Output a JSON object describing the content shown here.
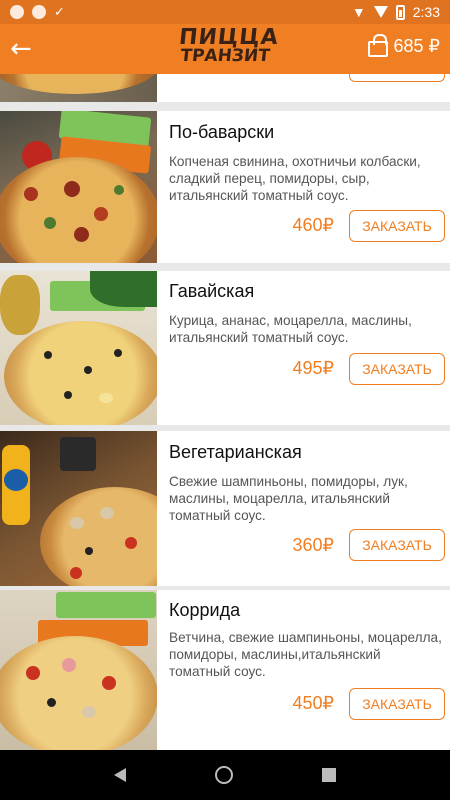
{
  "status_bar": {
    "time": "2:33"
  },
  "app_bar": {
    "logo_line1": "ПИЦЦА",
    "logo_line2": "ТРАНЗИТ",
    "cart_total": "685 ₽"
  },
  "items": [
    {
      "name": "",
      "description": "",
      "price": "",
      "order_label": "",
      "colors": {
        "bg": "#7a7160",
        "crust": "#c58a3c"
      }
    },
    {
      "name": "По-баварски",
      "description": "Копченая свинина, охотничьи колбаски, сладкий перец, помидоры, сыр, итальянский томатный соус.",
      "price": "460₽",
      "order_label": "ЗАКАЗАТЬ",
      "colors": {
        "bg": "#6d5b4a",
        "crust": "#c97a3a"
      }
    },
    {
      "name": "Гавайская",
      "description": "Курица, ананас, моцарелла, маслины, итальянский томатный соус.",
      "price": "495₽",
      "order_label": "ЗАКАЗАТЬ",
      "colors": {
        "bg": "#e8dcc4",
        "crust": "#d9a85a"
      }
    },
    {
      "name": "Вегетарианская",
      "description": "Свежие шампиньоны, помидоры, лук, маслины, моцарелла, итальянский томатный соус.",
      "price": "360₽",
      "order_label": "ЗАКАЗАТЬ",
      "colors": {
        "bg": "#6b4a2e",
        "crust": "#d39b52"
      }
    },
    {
      "name": "Коррида",
      "description": "Ветчина, свежие шампиньоны, моцарелла, помидоры, маслины,итальянский томатный соус.",
      "price": "450₽",
      "order_label": "ЗАКАЗАТЬ",
      "colors": {
        "bg": "#d9d2c0",
        "crust": "#d9a95c"
      }
    }
  ]
}
